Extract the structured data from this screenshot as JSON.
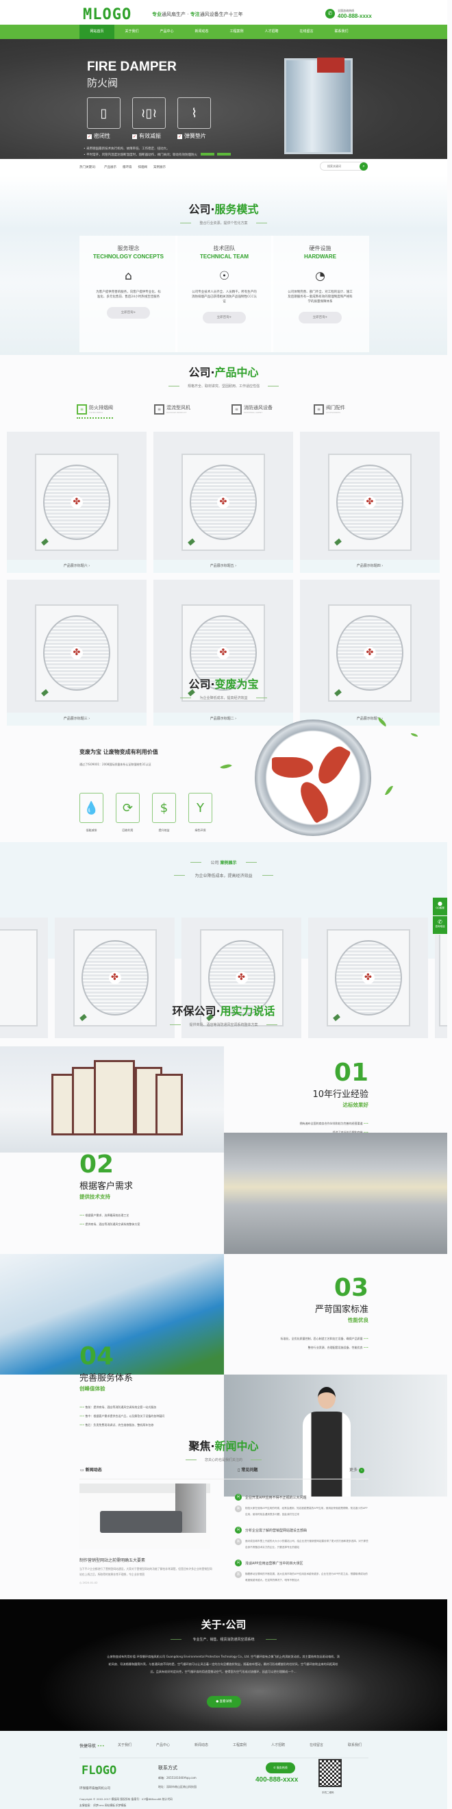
{
  "header": {
    "logo": "MLOGO",
    "slogan_a": "专业",
    "slogan_b": "通风扇生产 · ",
    "slogan_c": "专注",
    "slogan_d": "通风设备生产十三年",
    "hotline_label": "全国咨询热线",
    "hotline": "400-888-xxxx"
  },
  "nav": [
    {
      "label": "网站首页",
      "active": true
    },
    {
      "label": "关于我们"
    },
    {
      "label": "产品中心"
    },
    {
      "label": "新闻动态"
    },
    {
      "label": "工程案例"
    },
    {
      "label": "人才招聘"
    },
    {
      "label": "在线留言"
    },
    {
      "label": "联系我们"
    }
  ],
  "banner": {
    "title": "FIRE DAMPER",
    "subtitle": "防火阀",
    "features": [
      "密闭性",
      "有效减振",
      "弹簧垫片"
    ],
    "notes": [
      "• 采用德国最新技术执行机构、故障率低、工作稳定、扭动大。",
      "• 平时常开，风管内温度达熔断温度时，熔断器动作，阀门关闭；联动有效防烟防火"
    ]
  },
  "keywords": {
    "label": "热门关键词：",
    "items": [
      "产品展示",
      "循环扇",
      "排烟阀",
      "案例展示"
    ],
    "search_placeholder": "搜索关键词"
  },
  "services": {
    "title_a": "公司·",
    "title_b": "服务模式",
    "subtitle": "整合行业资源，提供个性化方案",
    "cards": [
      {
        "cn": "服务理念",
        "en": "TECHNOLOGY CONCEPTS",
        "icon": "shop-sale-icon",
        "text": "为客户提供完善的服务，向客户提供专业化、标准化、多元化售前、售后24小时热线至佳服务",
        "btn": "立即咨询+"
      },
      {
        "cn": "技术团队",
        "en": "TECHNICAL TEAM",
        "icon": "head-search-icon",
        "text": "公司专业技术人员齐全、人员精干。所有生产的消防排烟产品已获得相关消防产品强制性CCC认证",
        "btn": "立即咨询+"
      },
      {
        "cn": "硬件设施",
        "en": "HARDWARE",
        "icon": "gauge-icon",
        "text": "公司体制完善、部门齐全、对工程的设计、施工及后期服务有一套成熟有效的管理制度和严格科学的质量保障体系",
        "btn": "立即咨询+"
      }
    ]
  },
  "products": {
    "title_a": "公司·",
    "title_b": "产品中心",
    "subtitle": "规格齐全、取材讲究、坚固耐用、工作适应性强",
    "tabs": [
      {
        "cn": "防火排烟阀",
        "en": "FILTER PRESS",
        "active": true
      },
      {
        "cn": "混流型风机",
        "en": "PACKAGE PRODUCT"
      },
      {
        "cn": "消防通风设备",
        "en": "MATCHING AGENT"
      },
      {
        "cn": "阀门配件",
        "en": "ACCESSORIES"
      }
    ],
    "items": [
      "产品展示标题六  ›",
      "产品展示标题五  ›",
      "产品展示标题四  ›",
      "产品展示标题三  ›",
      "产品展示标题二  ›",
      "产品展示标题一  ›"
    ]
  },
  "waste": {
    "title_a": "公司·",
    "title_b": "变废为宝",
    "subtitle": "为企业降低成本，提高经济效益",
    "heading": "变废为宝 让废物变成有利用价值",
    "desc": "通过了ISO9001：2008国际质量体系认证和强制性3C认证",
    "icons": [
      {
        "label": "低能减排",
        "icon": "water-drop-icon",
        "glyph": "💧"
      },
      {
        "label": "回收利用",
        "icon": "recycle-icon",
        "glyph": "⟳"
      },
      {
        "label": "提升效益",
        "icon": "coins-icon",
        "glyph": "$"
      },
      {
        "label": "绿色环保",
        "icon": "sprout-icon",
        "glyph": "Y"
      }
    ]
  },
  "cases": {
    "title_a": "公司 ",
    "title_b": "案例展示",
    "subtitle": "为企业降低成本，提高经济效益"
  },
  "float": [
    {
      "label": "QQ客服",
      "icon": "qq-icon"
    },
    {
      "label": "咨询电话",
      "icon": "phone-icon"
    }
  ],
  "strength": {
    "title_a": "环保公司·",
    "title_b": "用实力说话",
    "subtitle": "提供商场、酒店等消防通风空调系统整体方案",
    "items": [
      {
        "num": "01",
        "h": "10年行业经验",
        "s": "达标效果好",
        "bullets": [
          "拥有遍布全国的商务合作伙伴和较为完善的经营渠道",
          "缔造了良好的品牌和商誉"
        ]
      },
      {
        "num": "02",
        "h": "根据客户需求",
        "s": "提供技术支持",
        "bullets": [
          "根据客户需求、选择最高效处理工艺",
          "提供商场、酒店等消防通风空调系统整体方案"
        ]
      },
      {
        "num": "03",
        "h": "严苛国家标准",
        "s": "性能优良",
        "bullets": [
          "标准化、全优化质量控制、匠心制造工艺和加工设备、确保产品质量",
          "整合行业资源、合理配套设施设备、性能优良"
        ]
      },
      {
        "num": "04",
        "h": "完善服务体系",
        "s": "创峰值体验",
        "bullets": [
          "售前：提供商场、酒店等消防通风空调系统全套一站式服务",
          "售中：根据客户需求提供合适产品，以及解答关于设备的各种疑问",
          "售后：负责免费现场调试、终生维修服务、整机两年包修"
        ]
      }
    ]
  },
  "news": {
    "title_a": "聚焦·",
    "title_b": "新闻中心",
    "subtitle": "您关心的也是我们关注的",
    "tab_news": "新闻动态",
    "tab_faq": "常见问题",
    "more": "更多",
    "article": {
      "title": "制作营销型网站之前需明确五大要素",
      "summary": "当下不少企业都进行了营销型网站建设，大家对于营销型网站的功能了解也非常清楚。但是还有许多企业的营销型网站在上线之后，所取得的效果非常不理想，令企业非常困",
      "date": "2020-01-02"
    },
    "faq": [
      {
        "q": "企业开发APP应用不得不正视的三大问题",
        "a": "相信大家在使用APP应用的时候，经常会遇到，知名度越是高的APP应用，使用起来就越是顺畅，知名度小的APP应用，使用时就会遇到很多问题，因此我们在过来"
      },
      {
        "q": "分析企业需了解的营销型网站建设五部曲",
        "a": "面对成百城市里上兴起的大大小小的建站公司，给企业进行营销型网站建设带了更大的方面和更多选择。对于那些自身不具备技术实力的企业，只要选择专业的建站"
      },
      {
        "q": "浅谈APP应用运营推广当中的四大误区",
        "a": "随着移动互联网的不断发展，各大应用市场的APP应用技术越来越多，企业在进行APP开发之后，想要取得成功的难度就越来越大。在这样的情况下，唯有不断加大"
      }
    ]
  },
  "about": {
    "title": "关于·公司",
    "subtitle": "专业生产、销售、租赁消防通风空调系统",
    "text": "让废物变成有利用价值 环保循环扇抽风机公司 Guangdong Environmental Protection Technology Co., Ltd. 空气循环扇有点像飞机上的涡轮发动机，其主要结构包括驱动电机、涡轮风扇、导流格栅和圆筒外壳，与普通风扇不同的是，空气循环扇可以让风沿着一定的方向呈螺旋状吹出，随着扇叶摆动，最终可形成螺旋形的柱状风，空气循环扇吹出来的风距离较远，且具有较好的定向性，空气循环扇的用途是搅动空气，使得室内空气形成对流循环，因此可以把它理解成一个...",
    "btn": "查看详情"
  },
  "footer": {
    "nav_label": "快捷导航",
    "nav": [
      "关于我们",
      "产品中心",
      "新闻动态",
      "工程案例",
      "人才招聘",
      "在线留言",
      "联系我们"
    ],
    "logo": "FLOGO",
    "company": "环保循环扇抽风机公司",
    "contact_title": "联系方式",
    "email": "邮箱：2655101040#qq.com",
    "address": "地址：深圳市南山区南山科技园",
    "hotline_btn": "服务热线",
    "hotline": "400-888-xxxx",
    "qr_label": "手机二维码",
    "copyright": "Copyright © 2002-2017 模板网 版权所有  备案号：ICP备888xxx88  统计代码",
    "links": "友情链接：  织梦cms   网站模板   织梦模板"
  },
  "colors": {
    "brand_green": "#2fa12a",
    "nav_green": "#5db83b"
  }
}
